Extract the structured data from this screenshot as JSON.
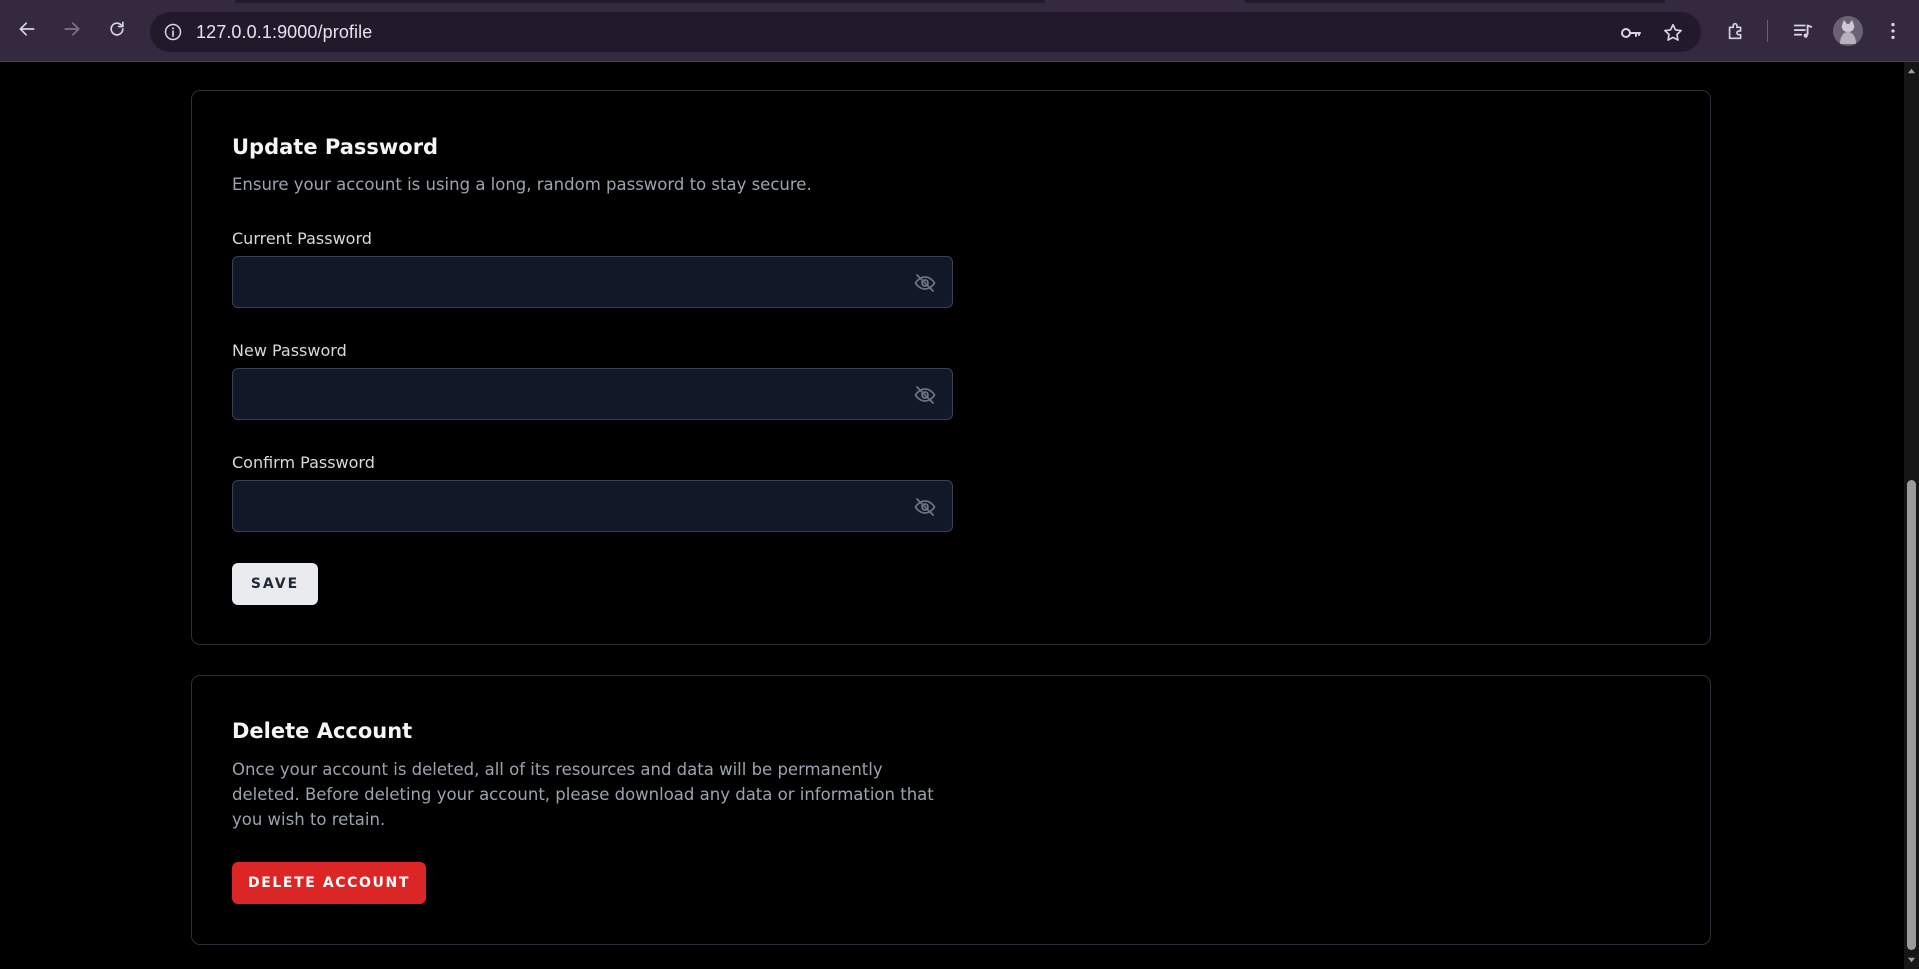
{
  "browser": {
    "url": "127.0.0.1:9000/profile"
  },
  "update_password": {
    "title": "Update Password",
    "description": "Ensure your account is using a long, random password to stay secure.",
    "fields": [
      {
        "label": "Current Password",
        "value": ""
      },
      {
        "label": "New Password",
        "value": ""
      },
      {
        "label": "Confirm Password",
        "value": ""
      }
    ],
    "save_label": "SAVE"
  },
  "delete_account": {
    "title": "Delete Account",
    "description": "Once your account is deleted, all of its resources and data will be permanently deleted. Before deleting your account, please download any data or information that you wish to retain.",
    "button_label": "DELETE ACCOUNT",
    "button_color": "#dc2626"
  },
  "icons": {
    "back": "arrow-left-icon",
    "forward": "arrow-right-icon",
    "reload": "reload-icon",
    "site_info": "info-icon",
    "password_manager": "key-icon",
    "bookmark": "star-icon",
    "extensions": "puzzle-icon",
    "media": "playlist-icon",
    "menu": "kebab-menu-icon",
    "field_toggle": "eye-slash-icon"
  }
}
